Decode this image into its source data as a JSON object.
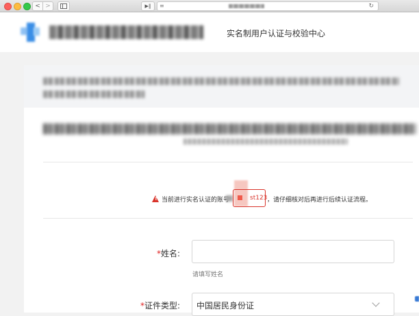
{
  "browser": {
    "back_label": "<",
    "forward_label": ">",
    "sidebar_icon": "sidebar-icon",
    "url_menu_icon": "≡",
    "reload_icon": "↻",
    "play_icon": "▶‖"
  },
  "header": {
    "subtitle": "实名制用户认证与校验中心",
    "logo_color": "#3a8ee6"
  },
  "warning": {
    "prefix": "当前进行实名认证的账号",
    "account_suffix": "st123",
    "suffix": "，请仔细核对后再进行后续认证流程。",
    "color": "#d9342b"
  },
  "form": {
    "name_label": "姓名:",
    "name_value": "",
    "name_hint": "请填写姓名",
    "id_type_label": "证件类型:",
    "id_type_value": "中国居民身份证",
    "required_mark": "*"
  }
}
